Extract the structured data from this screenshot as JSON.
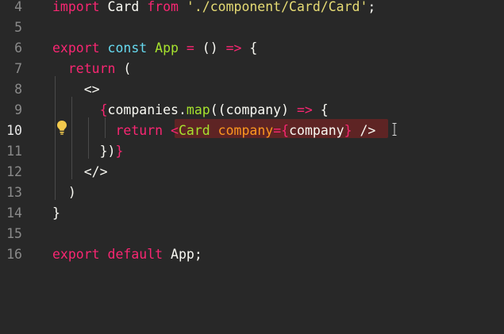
{
  "editor": {
    "lines": [
      {
        "num": "4",
        "tokens": [
          {
            "t": "import",
            "c": "kw"
          },
          {
            "t": " Card ",
            "c": "txt"
          },
          {
            "t": "from",
            "c": "kw"
          },
          {
            "t": " ",
            "c": "txt"
          },
          {
            "t": "'./component/Card/Card'",
            "c": "str"
          },
          {
            "t": ";",
            "c": "txt"
          }
        ]
      },
      {
        "num": "5",
        "tokens": []
      },
      {
        "num": "6",
        "tokens": [
          {
            "t": "export",
            "c": "kw"
          },
          {
            "t": " ",
            "c": "txt"
          },
          {
            "t": "const",
            "c": "kb"
          },
          {
            "t": " ",
            "c": "txt"
          },
          {
            "t": "App",
            "c": "fn"
          },
          {
            "t": " ",
            "c": "txt"
          },
          {
            "t": "=",
            "c": "kw"
          },
          {
            "t": " () ",
            "c": "txt"
          },
          {
            "t": "=>",
            "c": "kw"
          },
          {
            "t": " {",
            "c": "txt"
          }
        ]
      },
      {
        "num": "7",
        "tokens": [
          {
            "t": "  ",
            "c": "txt"
          },
          {
            "t": "return",
            "c": "kw"
          },
          {
            "t": " (",
            "c": "txt"
          }
        ]
      },
      {
        "num": "8",
        "tokens": [
          {
            "t": "    <>",
            "c": "txt"
          }
        ]
      },
      {
        "num": "9",
        "tokens": [
          {
            "t": "      ",
            "c": "txt"
          },
          {
            "t": "{",
            "c": "kw"
          },
          {
            "t": "companies.",
            "c": "txt"
          },
          {
            "t": "map",
            "c": "fn"
          },
          {
            "t": "((company) ",
            "c": "txt"
          },
          {
            "t": "=>",
            "c": "kw"
          },
          {
            "t": " {",
            "c": "txt"
          }
        ]
      },
      {
        "num": "10",
        "active": true,
        "tokens": [
          {
            "t": "        ",
            "c": "txt"
          },
          {
            "t": "return",
            "c": "kw"
          },
          {
            "t": " ",
            "c": "txt"
          },
          {
            "t": "<",
            "c": "kw"
          },
          {
            "t": "Card",
            "c": "fn"
          },
          {
            "t": " ",
            "c": "txt"
          },
          {
            "t": "company",
            "c": "attr"
          },
          {
            "t": "=",
            "c": "kw"
          },
          {
            "t": "{",
            "c": "kw"
          },
          {
            "t": "company",
            "c": "txt"
          },
          {
            "t": "}",
            "c": "kw"
          },
          {
            "t": " />",
            "c": "txt"
          }
        ]
      },
      {
        "num": "11",
        "tokens": [
          {
            "t": "      })",
            "c": "txt"
          },
          {
            "t": "}",
            "c": "kw"
          }
        ]
      },
      {
        "num": "12",
        "tokens": [
          {
            "t": "    </>",
            "c": "txt"
          }
        ]
      },
      {
        "num": "13",
        "tokens": [
          {
            "t": "  )",
            "c": "txt"
          }
        ]
      },
      {
        "num": "14",
        "tokens": [
          {
            "t": "}",
            "c": "txt"
          }
        ]
      },
      {
        "num": "15",
        "tokens": []
      },
      {
        "num": "16",
        "tokens": [
          {
            "t": "export",
            "c": "kw"
          },
          {
            "t": " ",
            "c": "txt"
          },
          {
            "t": "default",
            "c": "kw"
          },
          {
            "t": " App;",
            "c": "txt"
          }
        ]
      }
    ]
  },
  "icons": {
    "lightbulb": "lightbulb-icon",
    "cursor": "text-cursor-icon"
  },
  "colors": {
    "background": "#282828",
    "keyword": "#f92672",
    "builtin": "#66d9ef",
    "function": "#a6e22e",
    "string": "#e6db74",
    "attribute": "#fd971f",
    "text": "#f8f8f2",
    "selection": "#5e2424",
    "lightbulb": "#f2c94c"
  }
}
